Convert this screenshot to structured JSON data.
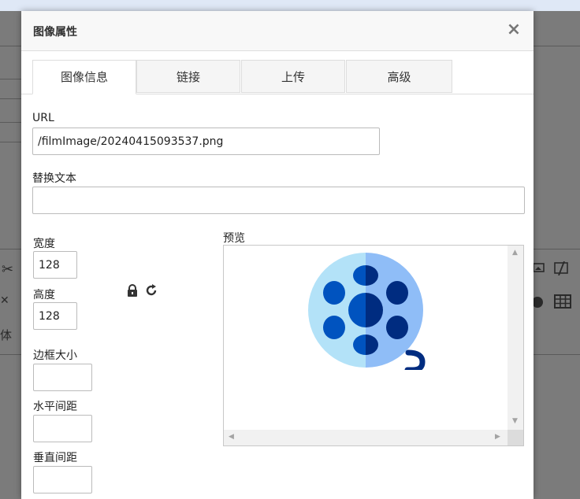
{
  "dialog": {
    "title": "图像属性",
    "close_glyph": "×",
    "tabs": [
      {
        "label": "图像信息",
        "active": true
      },
      {
        "label": "链接",
        "active": false
      },
      {
        "label": "上传",
        "active": false
      },
      {
        "label": "高级",
        "active": false
      }
    ]
  },
  "form": {
    "url_label": "URL",
    "url_value": "/filmImage/20240415093537.png",
    "alt_label": "替换文本",
    "alt_value": "",
    "width_label": "宽度",
    "width_value": "128",
    "height_label": "高度",
    "height_value": "128",
    "border_label": "边框大小",
    "border_value": "",
    "hspace_label": "水平间距",
    "hspace_value": "",
    "vspace_label": "垂直间距",
    "vspace_value": "",
    "lock_icon": "lock-icon",
    "reset_icon": "reset-size-icon"
  },
  "preview": {
    "label": "预览",
    "image_icon": "film-reel-icon"
  },
  "background": {
    "fragment_text": "体"
  },
  "colors": {
    "overlay": "#7b7b7b",
    "reel_light": "#b3e2f8",
    "reel_mid": "#8fbdf7",
    "reel_blue": "#0053bf",
    "reel_dark": "#002c80"
  }
}
